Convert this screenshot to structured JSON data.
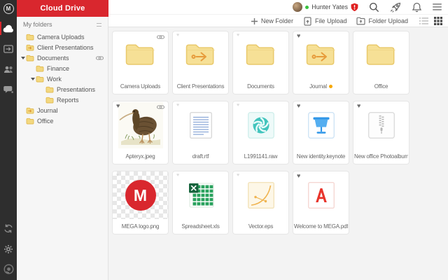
{
  "app": {
    "title": "Cloud Drive"
  },
  "topbar": {
    "user_name": "Hunter Yates",
    "user_status": "online",
    "icons": [
      "membership-shield",
      "search",
      "rocket-upgrade",
      "notifications-bell",
      "menu"
    ]
  },
  "toolbar": {
    "new_folder_label": "New Folder",
    "file_upload_label": "File Upload",
    "folder_upload_label": "Folder Upload",
    "view_modes": [
      "list",
      "grid"
    ],
    "active_view": "grid"
  },
  "rail": {
    "items": [
      "mega-logo",
      "cloud-drive",
      "incoming-shares",
      "contacts",
      "chat"
    ],
    "bottom_items": [
      "sync",
      "settings",
      "app-lens"
    ],
    "active_item": "cloud-drive"
  },
  "sidebar": {
    "header_label": "My folders",
    "items": [
      {
        "label": "Camera Uploads",
        "indent": 1,
        "icon": "folder",
        "expanded": false,
        "has_link": false
      },
      {
        "label": "Client Presentations",
        "indent": 1,
        "icon": "folder-shared",
        "expanded": false,
        "has_link": false
      },
      {
        "label": "Documents",
        "indent": 1,
        "icon": "folder",
        "expanded": true,
        "has_link": true
      },
      {
        "label": "Finance",
        "indent": 2,
        "icon": "folder",
        "expanded": false,
        "has_link": false
      },
      {
        "label": "Work",
        "indent": 2,
        "icon": "folder",
        "expanded": true,
        "has_link": false
      },
      {
        "label": "Presentations",
        "indent": 3,
        "icon": "folder",
        "expanded": false,
        "has_link": false
      },
      {
        "label": "Reports",
        "indent": 3,
        "icon": "folder",
        "expanded": false,
        "has_link": false
      },
      {
        "label": "Journal",
        "indent": 1,
        "icon": "folder-shared",
        "expanded": false,
        "has_link": false
      },
      {
        "label": "Office",
        "indent": 1,
        "icon": "folder",
        "expanded": false,
        "has_link": false
      }
    ]
  },
  "grid": {
    "tiles": [
      {
        "label": "Camera Uploads",
        "kind": "folder",
        "heart": "none",
        "link": true,
        "label_dot": false
      },
      {
        "label": "Client Presentations",
        "kind": "folder-shared",
        "heart": "faint",
        "link": false,
        "label_dot": false
      },
      {
        "label": "Documents",
        "kind": "folder",
        "heart": "faint",
        "link": false,
        "label_dot": false
      },
      {
        "label": "Journal",
        "kind": "folder-shared",
        "heart": "filled",
        "link": false,
        "label_dot": true
      },
      {
        "label": "Office",
        "kind": "folder",
        "heart": "none",
        "link": false,
        "label_dot": false
      },
      {
        "label": "Apteryx.jpeg",
        "kind": "image-kiwi",
        "heart": "filled",
        "link": true,
        "label_dot": false
      },
      {
        "label": "draft.rtf",
        "kind": "rtf",
        "heart": "faint",
        "link": false,
        "label_dot": false
      },
      {
        "label": "L1991141.raw",
        "kind": "raw",
        "heart": "faint",
        "link": false,
        "label_dot": false
      },
      {
        "label": "New identity.keynote",
        "kind": "keynote",
        "heart": "filled",
        "link": false,
        "label_dot": false
      },
      {
        "label": "New office Photoalbum.zip",
        "kind": "zip",
        "heart": "filled",
        "link": false,
        "label_dot": false
      },
      {
        "label": "MEGA logo.png",
        "kind": "png-mega",
        "heart": "faint",
        "link": false,
        "label_dot": false
      },
      {
        "label": "Spreadsheet.xls",
        "kind": "xls",
        "heart": "faint",
        "link": false,
        "label_dot": false
      },
      {
        "label": "Vector.eps",
        "kind": "eps",
        "heart": "faint",
        "link": false,
        "label_dot": false
      },
      {
        "label": "Welcome to MEGA.pdf",
        "kind": "pdf",
        "heart": "filled",
        "link": false,
        "label_dot": false
      }
    ]
  },
  "colors": {
    "accent_red": "#d9272e",
    "rail_bg": "#2e2e2e",
    "sidebar_bg": "#f6f6f6",
    "main_bg": "#f3f3f3",
    "folder_yellow": "#f6e096",
    "folder_border": "#e9c96b",
    "share_arrow_orange": "#e79c3c",
    "heart_filled": "#6f6f6f",
    "heart_faint": "#dcdcdc",
    "label_dot_orange": "#f7a800",
    "status_green": "#39c23f"
  }
}
